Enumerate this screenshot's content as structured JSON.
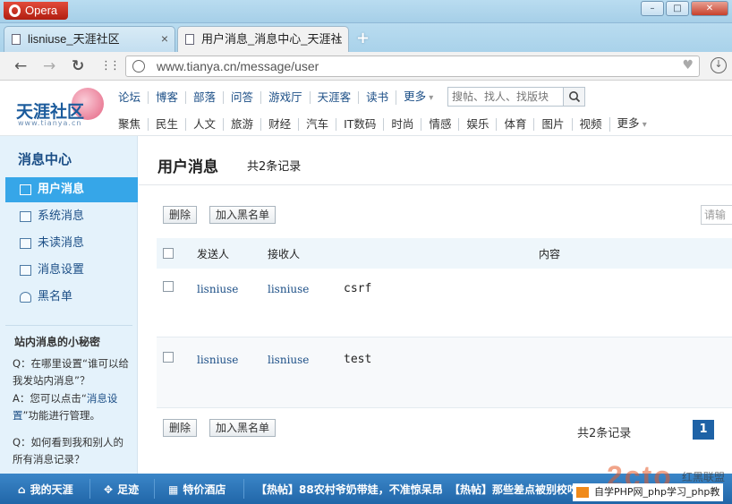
{
  "browser": {
    "app_name": "Opera",
    "tabs": [
      {
        "label": "lisniuse_天涯社区",
        "close": "×"
      },
      {
        "label": "用户消息_消息中心_天涯社",
        "close": "×"
      }
    ],
    "new_tab": "+",
    "url": "www.tianya.cn/message/user",
    "nav": {
      "back": "←",
      "forward": "→",
      "reload": "↻",
      "grid": "⋮⋮",
      "download": "↓"
    },
    "window_controls": {
      "minimize": "–",
      "maximize": "□",
      "close": "✕"
    }
  },
  "site": {
    "logo_text": "天涯社区",
    "logo_url": "www.tianya.cn",
    "nav_row1": [
      "论坛",
      "博客",
      "部落",
      "问答",
      "游戏厅",
      "天涯客",
      "读书",
      "更多"
    ],
    "nav_row2": [
      "聚焦",
      "民生",
      "人文",
      "旅游",
      "财经",
      "汽车",
      "IT数码",
      "时尚",
      "情感",
      "娱乐",
      "体育",
      "图片",
      "视频",
      "更多"
    ],
    "search_placeholder": "搜帖、找人、找版块"
  },
  "sidebar": {
    "title": "消息中心",
    "items": [
      {
        "label": "用户消息",
        "icon": "envelope-icon",
        "active": true
      },
      {
        "label": "系统消息",
        "icon": "speaker-icon",
        "active": false
      },
      {
        "label": "未读消息",
        "icon": "unread-mail-icon",
        "active": false
      },
      {
        "label": "消息设置",
        "icon": "gear-icon",
        "active": false
      },
      {
        "label": "黑名单",
        "icon": "user-block-icon",
        "active": false
      }
    ],
    "tips_title": "站内消息的小秘密",
    "tips": [
      {
        "q": "Q：在哪里设置“谁可以给我发站内消息”？",
        "a_prefix": "A：您可以点击“",
        "a_link": "消息设置",
        "a_suffix": "”功能进行管理。"
      },
      {
        "q": "Q：如何看到我和别人的所有消息记录？"
      }
    ]
  },
  "main": {
    "title": "用户消息",
    "record_count": "共2条记录",
    "delete_button": "删除",
    "blacklist_button": "加入黑名单",
    "receiver_placeholder": "请输",
    "headers": {
      "sender": "发送人",
      "receiver": "接收人",
      "content": "内容"
    },
    "rows": [
      {
        "sender": "lisniuse",
        "receiver": "lisniuse",
        "content": "csrf"
      },
      {
        "sender": "lisniuse",
        "receiver": "lisniuse",
        "content": "test"
      }
    ],
    "footer_count": "共2条记录",
    "page": "1"
  },
  "bottombar": {
    "my_tianya": "我的天涯",
    "footprint": "足迹",
    "hotel": "特价酒店",
    "hot1": "【热帖】88农村爷奶带娃，不准惊呆昂",
    "hot2": "【热帖】那些差点被别校吃去"
  },
  "watermark": {
    "text": "自学PHP网_php学习_php教",
    "big": "2cto",
    "side": "红黑联盟"
  },
  "colors": {
    "accent": "#36a6e8",
    "link": "#1b4e86",
    "bottombar": "#2166a8",
    "page_active": "#1e62a6"
  }
}
